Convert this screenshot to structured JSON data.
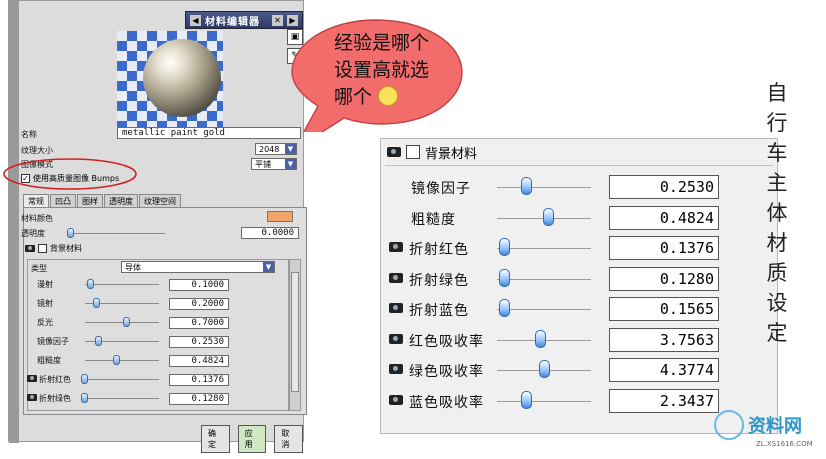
{
  "dialog": {
    "title": "材料编辑器",
    "name_label": "名称",
    "name_value": "metallic paint gold",
    "texture_size_label": "纹理大小",
    "texture_size_value": "2048",
    "shading_mode_label": "图像模式",
    "shading_mode_value": "平铺",
    "high_quality_bumps_label": "使用高质量图像 Bumps",
    "tabs": [
      "常规",
      "凹凸",
      "图样",
      "透明度",
      "纹理空间"
    ],
    "material_color_label": "材料颜色",
    "material_color_hex": "#f4a469",
    "transparency_label": "透明度",
    "transparency_value": "0.0000",
    "background_material_label": "背景材料",
    "type_label": "类型",
    "type_value": "导体",
    "properties": [
      {
        "label": "漫射",
        "value": "0.1000"
      },
      {
        "label": "镜射",
        "value": "0.2000"
      },
      {
        "label": "反光",
        "value": "0.7000"
      },
      {
        "label": "镜像因子",
        "value": "0.2530"
      },
      {
        "label": "粗糙度",
        "value": "0.4824"
      },
      {
        "label": "折射红色",
        "value": "0.1376"
      },
      {
        "label": "折射绿色",
        "value": "0.1280"
      }
    ],
    "buttons": {
      "ok": "确定",
      "apply": "应用",
      "cancel": "取消"
    }
  },
  "callout": {
    "line1": "经验是哪个",
    "line2": "设置高就选",
    "line3": "哪个"
  },
  "zoom_panel": {
    "header": "背景材料",
    "rows": [
      {
        "label": "镜像因子",
        "value": "0.2530",
        "icon": false,
        "level": 0.3
      },
      {
        "label": "粗糙度",
        "value": "0.4824",
        "icon": false,
        "level": 0.52
      },
      {
        "label": "折射红色",
        "value": "0.1376",
        "icon": true,
        "level": 0.08
      },
      {
        "label": "折射绿色",
        "value": "0.1280",
        "icon": true,
        "level": 0.08
      },
      {
        "label": "折射蓝色",
        "value": "0.1565",
        "icon": true,
        "level": 0.08
      },
      {
        "label": "红色吸收率",
        "value": "3.7563",
        "icon": true,
        "level": 0.44
      },
      {
        "label": "绿色吸收率",
        "value": "4.3774",
        "icon": true,
        "level": 0.48
      },
      {
        "label": "蓝色吸收率",
        "value": "2.3437",
        "icon": true,
        "level": 0.3
      }
    ]
  },
  "side_note": [
    "自",
    "行",
    "车",
    "主",
    "体",
    "材",
    "质",
    "设",
    "定"
  ],
  "watermark": {
    "text": "资料网",
    "sub": "ZL.XS1616.COM"
  },
  "colors": {
    "callout_fill": "#f26c6c",
    "highlight_ellipse": "#d32020",
    "knob": "#6fa3d9"
  }
}
